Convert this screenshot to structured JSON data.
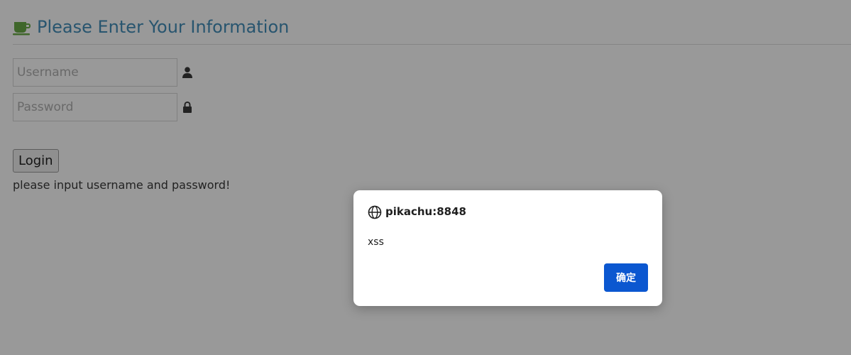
{
  "header": {
    "title": "Please Enter Your Information",
    "icon": "coffee-cup-icon",
    "icon_color": "#69aa46",
    "title_color": "#438eb9"
  },
  "form": {
    "username_placeholder": "Username",
    "username_value": "",
    "password_placeholder": "Password",
    "password_value": "",
    "username_icon": "user-icon",
    "password_icon": "lock-icon",
    "login_label": "Login",
    "message": "please input username and password!"
  },
  "dialog": {
    "origin": "pikachu:8848",
    "origin_icon": "globe-icon",
    "message": "xss",
    "ok_label": "确定",
    "ok_color": "#0b57d0"
  }
}
